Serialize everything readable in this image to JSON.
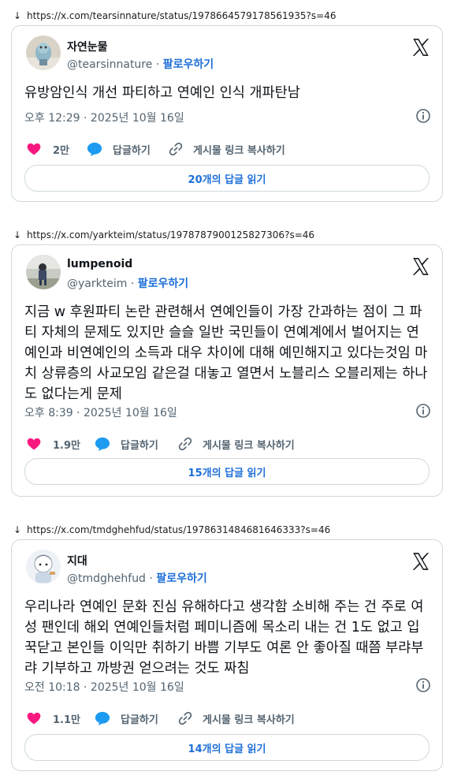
{
  "tweets": [
    {
      "url": "https://x.com/tearsinnature/status/1978664579178561935?s=46",
      "name": "자연눈물",
      "handle": "@tearsinnature",
      "follow": "팔로우하기",
      "text": "유방암인식 개선 파티하고 연예인 인식 개파탄남",
      "time": "오후 12:29 · 2025년 10월 16일",
      "likes": "2만",
      "reply_label": "답글하기",
      "copy_label": "게시물 링크 복사하기",
      "read_replies": "20개의 답글 읽기"
    },
    {
      "url": "https://x.com/yarkteim/status/1978787900125827306?s=46",
      "name": "lumpenoid",
      "handle": "@yarkteim",
      "follow": "팔로우하기",
      "text": "지금 w 후원파티 논란 관련해서 연예인들이 가장 간과하는 점이 그 파티 자체의 문제도 있지만 슬슬 일반 국민들이 연예계에서 벌어지는 연예인과 비연예인의 소득과 대우 차이에 대해 예민해지고 있다는것임 마치 상류층의 사교모임 같은걸 대놓고 열면서 노블리스 오블리제는 하나도 없다는게 문제",
      "time": "오후 8:39 · 2025년 10월 16일",
      "likes": "1.9만",
      "reply_label": "답글하기",
      "copy_label": "게시물 링크 복사하기",
      "read_replies": "15개의 답글 읽기"
    },
    {
      "url": "https://x.com/tmdghehfud/status/1978631484681646333?s=46",
      "name": "지대",
      "handle": "@tmdghehfud",
      "follow": "팔로우하기",
      "text": "우리나라 연예인 문화 진심 유해하다고 생각함 소비해 주는 건 주로 여성 팬인데 해외 연예인들처럼 페미니즘에 목소리 내는 건 1도 없고 입꾹닫고 본인들 이익만 취하기 바쁨 기부도 여론 안 좋아질 때쯤 부랴부랴 기부하고 까방권 얻으려는 것도 짜침",
      "time": "오전 10:18 · 2025년 10월 16일",
      "likes": "1.1만",
      "reply_label": "답글하기",
      "copy_label": "게시물 링크 복사하기",
      "read_replies": "14개의 답글 읽기"
    }
  ],
  "arrow_glyph": "↓",
  "colors": {
    "like": "#f91880",
    "reply": "#1d9bf0",
    "link": "#1d6fd8",
    "border": "#cfd9de"
  }
}
